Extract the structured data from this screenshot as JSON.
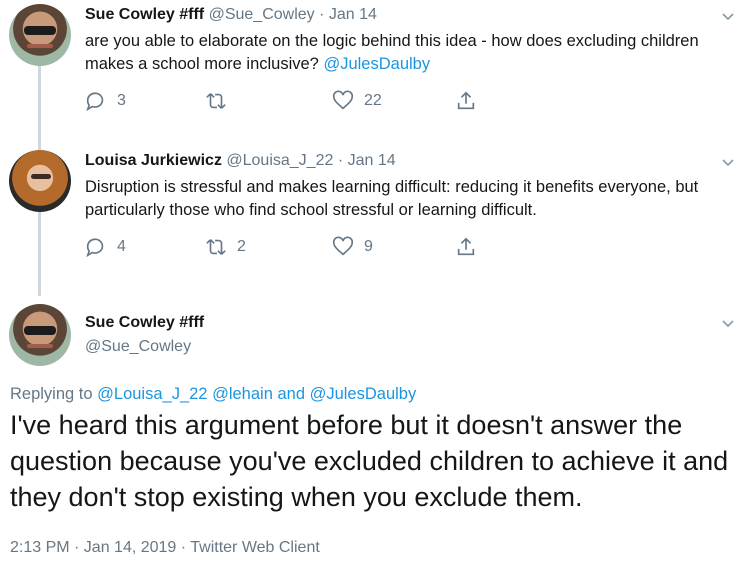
{
  "tweets": [
    {
      "name": "Sue Cowley #fff",
      "handle": "@Sue_Cowley",
      "dot": "·",
      "date": "Jan 14",
      "text": "are you able to elaborate on the logic behind this idea - how does excluding children makes a school more inclusive?",
      "mention": "@JulesDaulby",
      "replies": "3",
      "retweets": "",
      "likes": "22",
      "avatar_icon": "profile-photo"
    },
    {
      "name": "Louisa Jurkiewicz",
      "handle": "@Louisa_J_22",
      "dot": "·",
      "date": "Jan 14",
      "text": "Disruption is stressful and makes learning difficult: reducing it benefits everyone, but particularly those who find school stressful or learning difficult.",
      "replies": "4",
      "retweets": "2",
      "likes": "9",
      "avatar_icon": "profile-photo"
    }
  ],
  "focused": {
    "name": "Sue Cowley #fff",
    "handle": "@Sue_Cowley",
    "replying_prefix": "Replying to",
    "replying_1": "@Louisa_J_22",
    "replying_2": "@lehain",
    "replying_and": "and",
    "replying_3": "@JulesDaulby",
    "text": "I've heard this argument before but it doesn't answer the question because you've excluded children to achieve it and they don't stop existing when you exclude them.",
    "meta": "2:13 PM · Jan 14, 2019 · Twitter Web Client"
  },
  "colors": {
    "text": "#14171a",
    "muted": "#657786",
    "link": "#1b95e0",
    "thread": "#cfd6dc"
  }
}
